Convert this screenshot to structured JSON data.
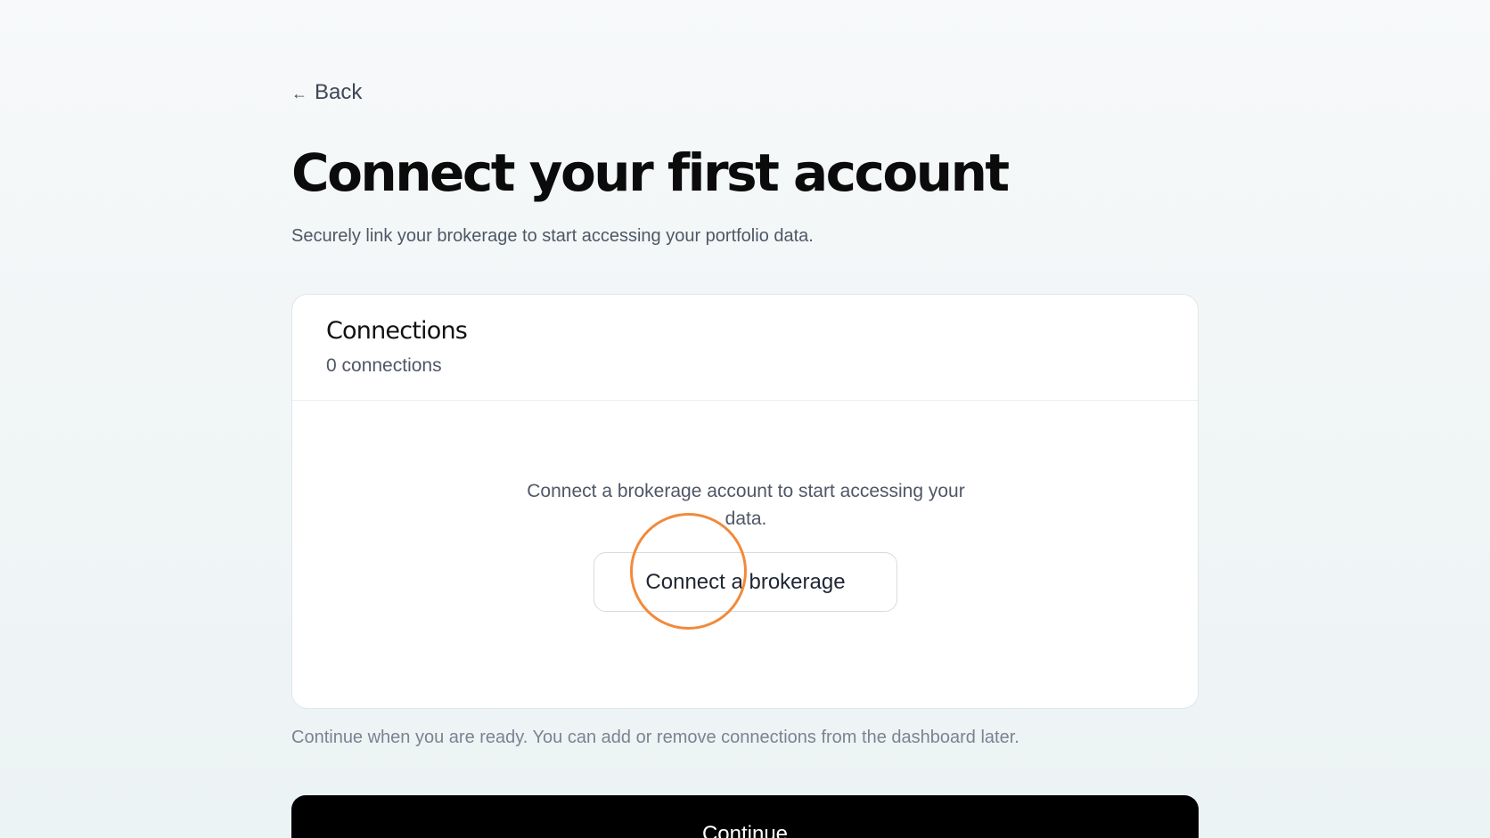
{
  "nav": {
    "back_arrow": "←",
    "back_label": "Back"
  },
  "header": {
    "title": "Connect your first account",
    "subtitle": "Securely link your brokerage to start accessing your portfolio data."
  },
  "connections": {
    "title": "Connections",
    "count_label": "0 connections",
    "empty_message": "Connect a brokerage account to start accessing your data.",
    "connect_button_label": "Connect a brokerage"
  },
  "footer": {
    "note": "Continue when you are ready. You can add or remove connections from the dashboard later.",
    "continue_label": "Continue"
  },
  "colors": {
    "accent_click_ring": "#f28a3a",
    "primary_button": "#000000"
  }
}
